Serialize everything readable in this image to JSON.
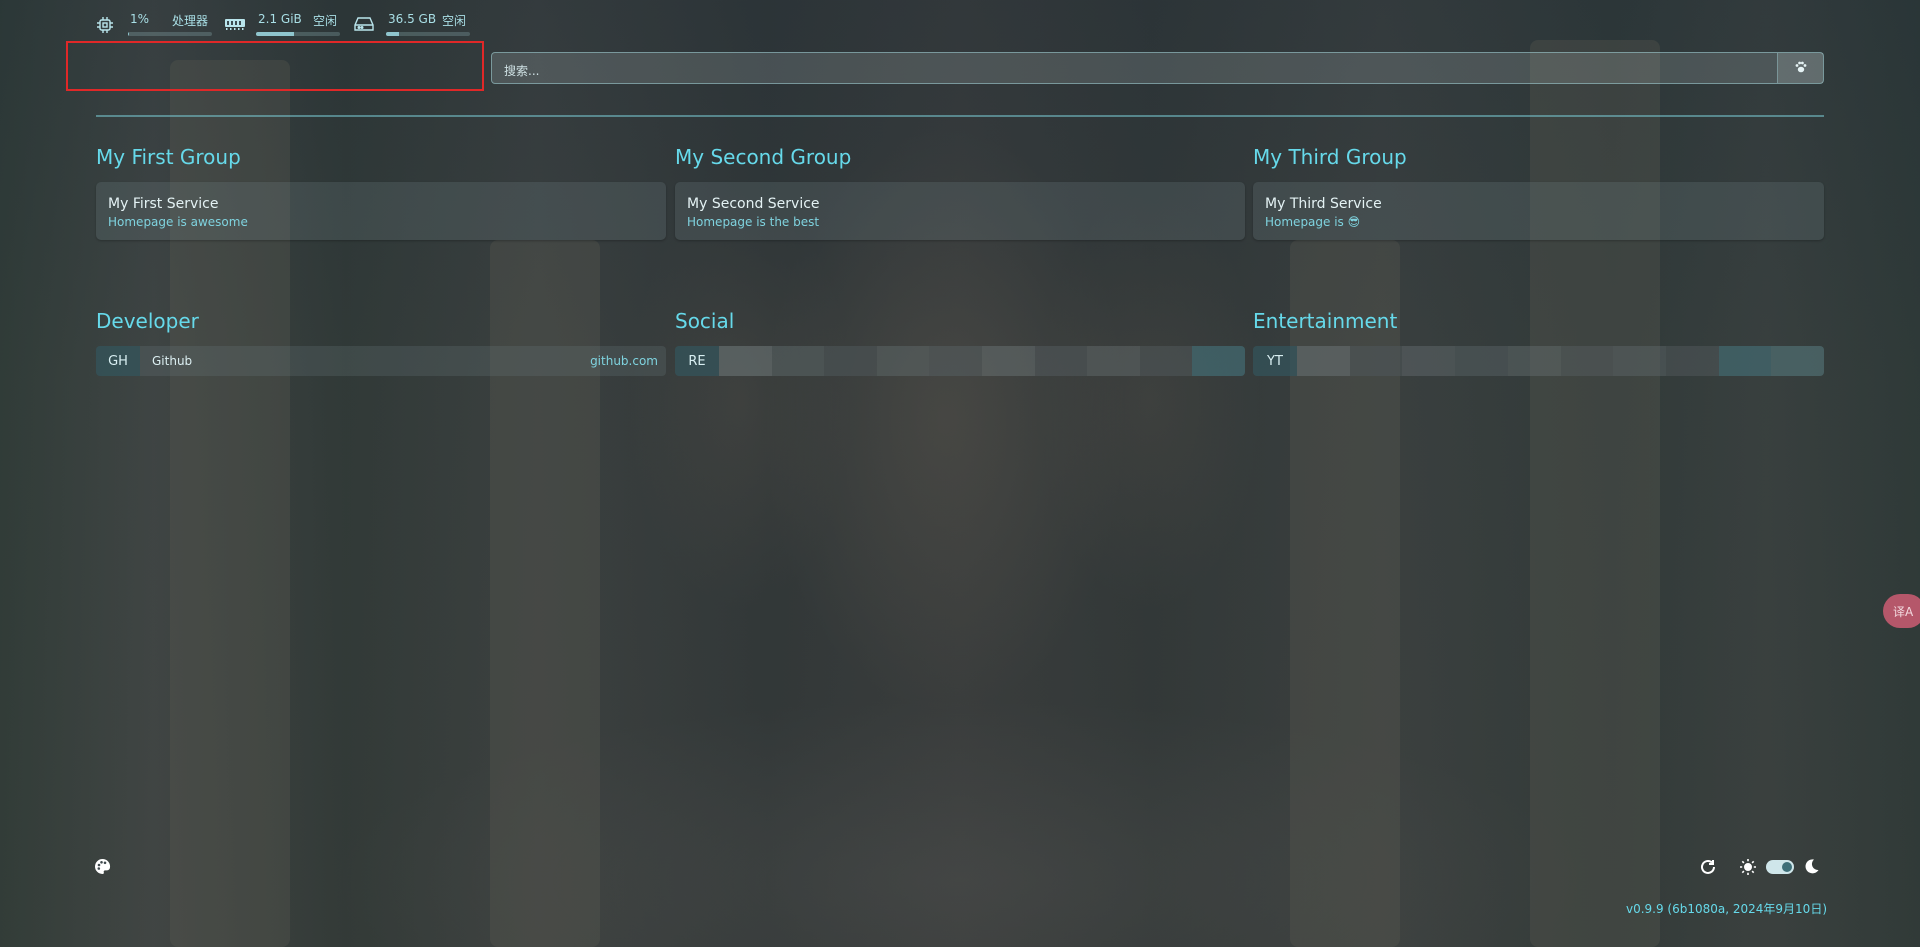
{
  "widgets": {
    "cpu": {
      "value": "1%",
      "label": "处理器",
      "usage": 0.01,
      "icon": "cpu-icon"
    },
    "memory": {
      "value": "2.1 GiB",
      "label": "空闲",
      "usage": 0.45,
      "icon": "memory-icon"
    },
    "disk": {
      "value": "36.5 GB",
      "label": "空闲",
      "usage": 0.15,
      "icon": "disk-icon"
    }
  },
  "search": {
    "placeholder": "搜索...",
    "engine_icon": "paw-icon"
  },
  "groups": [
    {
      "title": "My First Group",
      "service": {
        "name": "My First Service",
        "description": "Homepage is awesome"
      }
    },
    {
      "title": "My Second Group",
      "service": {
        "name": "My Second Service",
        "description": "Homepage is the best"
      }
    },
    {
      "title": "My Third Group",
      "service": {
        "name": "My Third Service",
        "description": "Homepage is 😎"
      }
    }
  ],
  "bookmarks": [
    {
      "title": "Developer",
      "abbr": "GH",
      "name": "Github",
      "url": "github.com"
    },
    {
      "title": "Social",
      "abbr": "RE"
    },
    {
      "title": "Entertainment",
      "abbr": "YT"
    }
  ],
  "footer": {
    "version": "v0.9.9 (6b1080a, 2024年9月10日)",
    "translate_label": "译A"
  },
  "colors": {
    "accent": "#66d9ea",
    "highlight_border": "#e02828"
  }
}
